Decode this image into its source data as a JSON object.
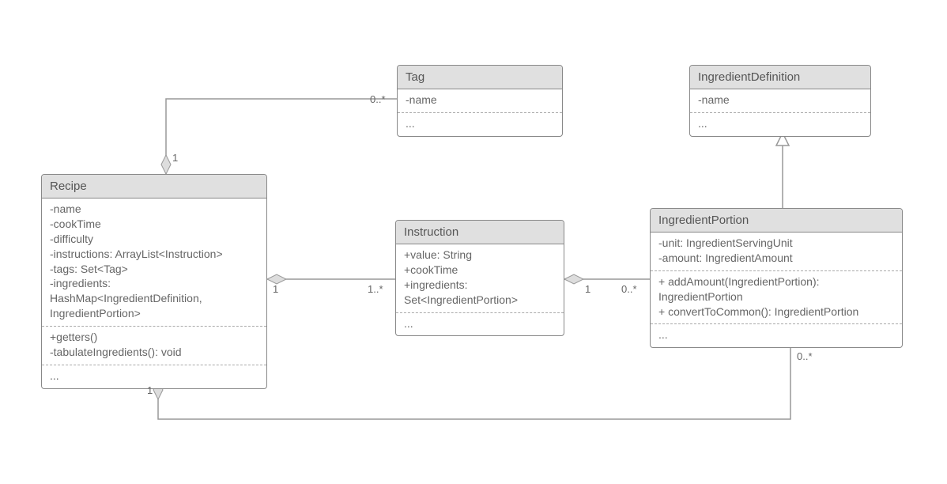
{
  "classes": {
    "recipe": {
      "title": "Recipe",
      "attrs": [
        "-name",
        "-cookTime",
        "-difficulty",
        "-instructions: ArrayList<Instruction>",
        "-tags: Set<Tag>",
        "-ingredients:",
        "HashMap<IngredientDefinition,",
        "IngredientPortion>"
      ],
      "methods": [
        "+getters()",
        "-tabulateIngredients(): void"
      ],
      "more": "..."
    },
    "tag": {
      "title": "Tag",
      "attrs": [
        "-name"
      ],
      "more": "..."
    },
    "ingredientDefinition": {
      "title": "IngredientDefinition",
      "attrs": [
        "-name"
      ],
      "more": "..."
    },
    "instruction": {
      "title": "Instruction",
      "attrs": [
        "+value: String",
        "+cookTime",
        "+ingredients:",
        "Set<IngredientPortion>"
      ],
      "more": "..."
    },
    "ingredientPortion": {
      "title": "IngredientPortion",
      "attrs": [
        "-unit: IngredientServingUnit",
        "-amount: IngredientAmount"
      ],
      "methods": [
        "+ addAmount(IngredientPortion):",
        "IngredientPortion",
        "+ convertToCommon(): IngredientPortion"
      ],
      "more": "..."
    }
  },
  "multiplicities": {
    "recipe_tag_recipe": "1",
    "recipe_tag_tag": "0..*",
    "recipe_instruction_recipe": "1",
    "recipe_instruction_instruction": "1..*",
    "instruction_portion_instruction": "1",
    "instruction_portion_portion": "0..*",
    "recipe_portion_recipe": "1",
    "recipe_portion_portion": "0..*"
  }
}
